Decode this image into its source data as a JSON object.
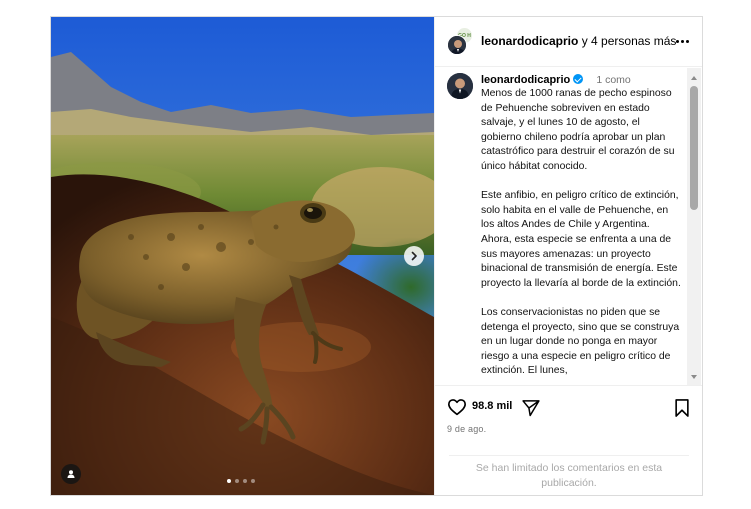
{
  "post": {
    "header": {
      "username": "leonardodicaprio",
      "collab_text": "y 4 personas más",
      "collab_avatar_text": "GO H",
      "more_icon": "more-horizontal-icon"
    },
    "media": {
      "slide_count": 4,
      "current_slide": 1,
      "icons": [
        "chevron-right-icon",
        "user-tag-icon"
      ]
    },
    "caption": {
      "username": "leonardodicaprio",
      "verified": true,
      "meta": "1 como",
      "paragraphs": [
        "Menos de 1000 ranas de pecho espinoso de Pehuenche sobreviven en estado salvaje, y el lunes 10 de agosto, el gobierno chileno podría aprobar un plan catastrófico para destruir el corazón de su único hábitat conocido.",
        "Este anfibio, en peligro crítico de extinción, solo habita en el valle de Pehuenche, en los altos Andes de Chile y Argentina. Ahora, esta especie se enfrenta a una de sus mayores amenazas: un proyecto binacional de transmisión de energía. Este proyecto la llevaría al borde de la extinción.",
        "Los conservacionistas no piden que se detenga el proyecto, sino que se construya en un lugar donde no ponga en mayor riesgo a una especie en peligro crítico de extinción. El lunes,"
      ]
    },
    "actions": {
      "likes": "98.8 mil",
      "date": "9 de ago.",
      "comments_limited": "Se han limitado los comentarios en esta publicación."
    },
    "colors": {
      "verified": "#0095f6",
      "border": "#dbdbdb",
      "muted": "#737373"
    }
  }
}
